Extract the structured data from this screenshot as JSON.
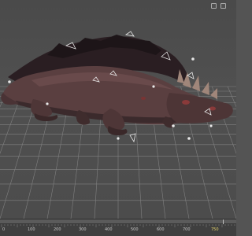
{
  "viewport": {
    "grid": true,
    "model": "crocodile-like creature",
    "selected_bones_visible": true
  },
  "timeline": {
    "frame_labels": [
      "0",
      "100",
      "200",
      "300",
      "400",
      "500",
      "600",
      "700",
      "750"
    ],
    "current_frame": 750
  },
  "colors": {
    "background": "#4f4f4f",
    "grid_lines": "#8a8a8a",
    "timeline_bg": "#444444",
    "creature_skin": "#5a3f40",
    "spikes": "#a0867a",
    "bone_markers": "#e8e8e8"
  },
  "icons": [
    "zoom-icon",
    "pan-icon"
  ]
}
